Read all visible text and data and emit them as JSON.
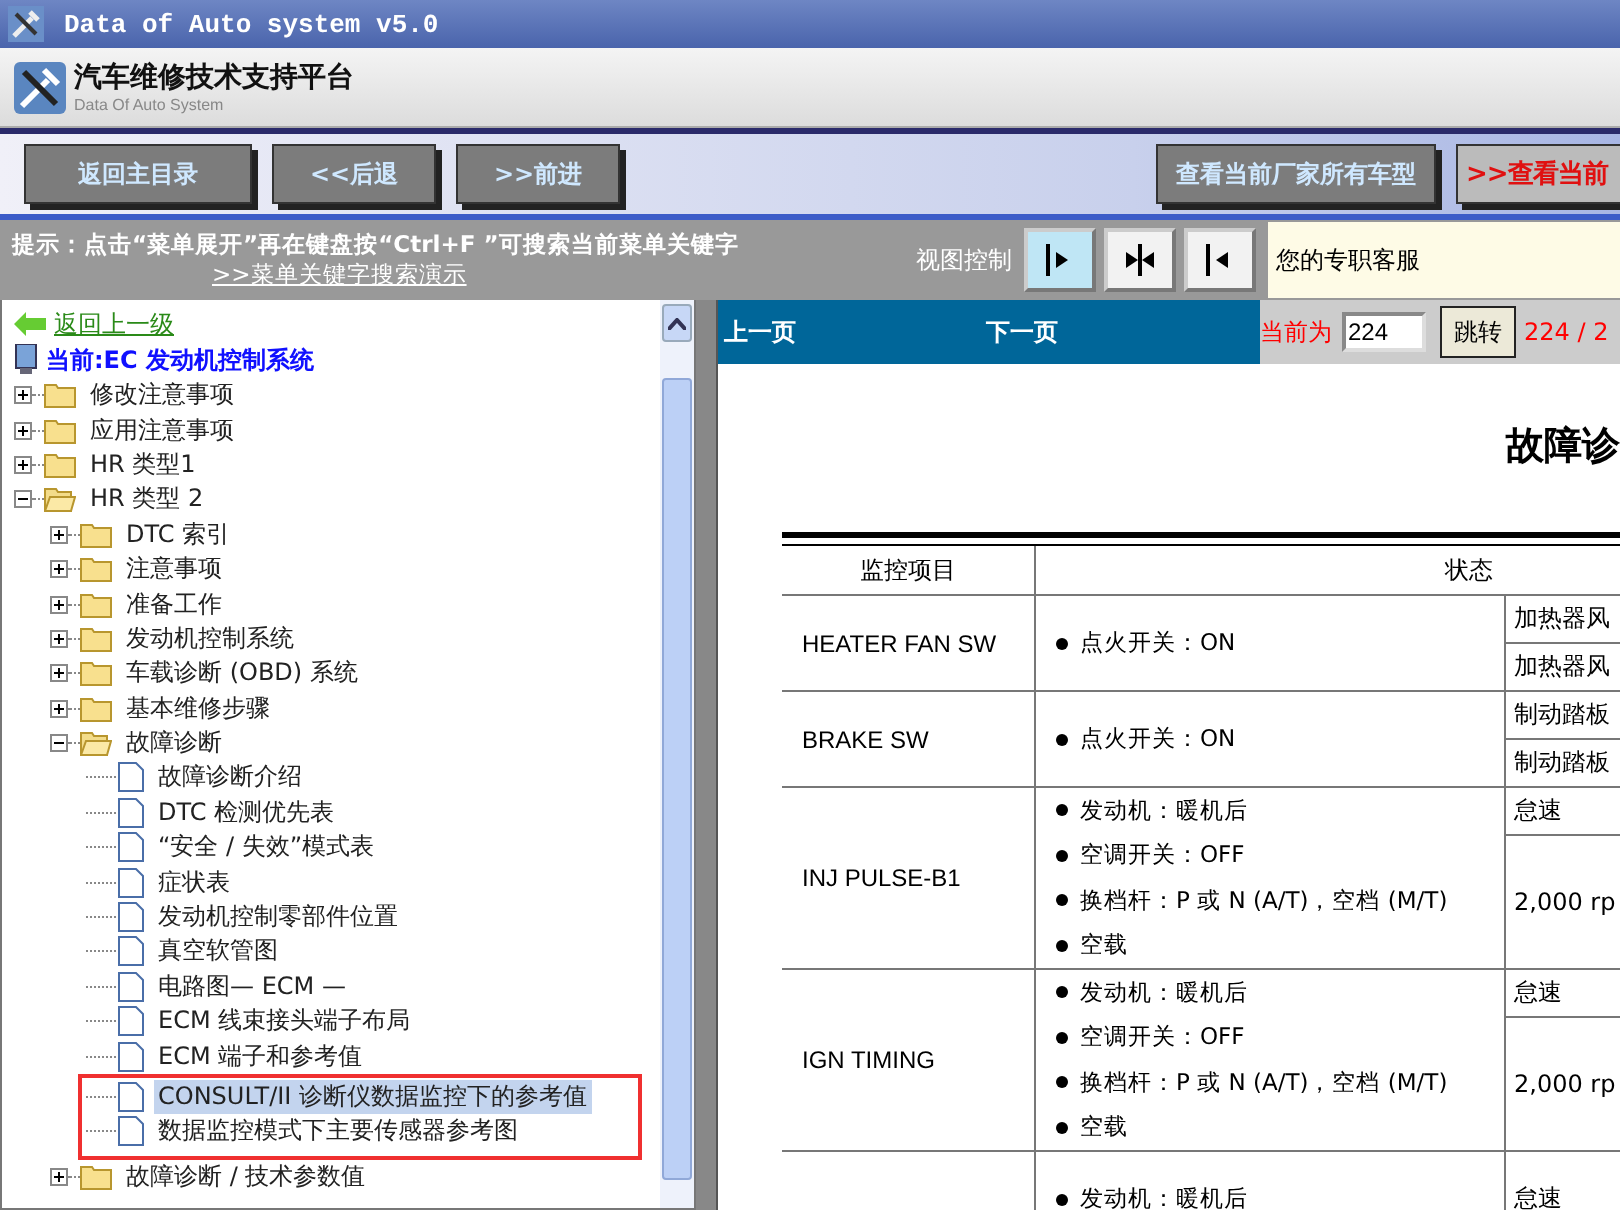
{
  "window": {
    "title": "Data of Auto system v5.0"
  },
  "header": {
    "title": "汽车维修技术支持平台",
    "subtitle": "Data Of Auto System"
  },
  "toolbar": {
    "buttons": [
      {
        "label": "返回主目录",
        "kind": "normal"
      },
      {
        "label": "<<后退",
        "kind": "normal"
      },
      {
        "label": ">>前进",
        "kind": "normal"
      },
      {
        "label": "查看当前厂家所有车型",
        "kind": "wide"
      },
      {
        "label": ">>查看当前",
        "kind": "alert"
      }
    ]
  },
  "hint": {
    "text": "提示：点击“菜单展开”再在键盘按“Ctrl+F ”可搜索当前菜单关键字",
    "link": ">>菜单关键字搜索演示"
  },
  "view_control": {
    "label": "视图控制",
    "buttons": [
      {
        "kind": "right"
      },
      {
        "kind": "collapse"
      },
      {
        "kind": "left"
      }
    ]
  },
  "service": {
    "text": "您的专职客服"
  },
  "tree": {
    "back": "返回上一级",
    "current": "当前:EC 发动机控制系统",
    "items": [
      {
        "label": "修改注意事项",
        "kind": "folder",
        "expanded": false,
        "selected": false,
        "annotated": false
      },
      {
        "label": "应用注意事项",
        "kind": "folder",
        "expanded": false,
        "selected": false,
        "annotated": false
      },
      {
        "label": "HR 类型1",
        "kind": "folder",
        "expanded": false,
        "selected": false,
        "annotated": false
      },
      {
        "label": "HR 类型  2",
        "kind": "folder",
        "expanded": true,
        "selected": false,
        "annotated": false,
        "children": [
          {
            "label": "DTC 索引",
            "kind": "folder",
            "expanded": false,
            "selected": false,
            "annotated": false
          },
          {
            "label": "注意事项",
            "kind": "folder",
            "expanded": false,
            "selected": false,
            "annotated": false
          },
          {
            "label": "准备工作",
            "kind": "folder",
            "expanded": false,
            "selected": false,
            "annotated": false
          },
          {
            "label": "发动机控制系统",
            "kind": "folder",
            "expanded": false,
            "selected": false,
            "annotated": false
          },
          {
            "label": "车载诊断 (OBD) 系统",
            "kind": "folder",
            "expanded": false,
            "selected": false,
            "annotated": false
          },
          {
            "label": "基本维修步骤",
            "kind": "folder",
            "expanded": false,
            "selected": false,
            "annotated": false
          },
          {
            "label": "故障诊断",
            "kind": "folder",
            "expanded": true,
            "selected": false,
            "annotated": false,
            "children": [
              {
                "label": "故障诊断介绍",
                "kind": "page",
                "selected": false,
                "annotated": false
              },
              {
                "label": "DTC 检测优先表",
                "kind": "page",
                "selected": false,
                "annotated": false
              },
              {
                "label": "“安全 / 失效”模式表",
                "kind": "page",
                "selected": false,
                "annotated": false
              },
              {
                "label": "症状表",
                "kind": "page",
                "selected": false,
                "annotated": false
              },
              {
                "label": "发动机控制零部件位置",
                "kind": "page",
                "selected": false,
                "annotated": false
              },
              {
                "label": "真空软管图",
                "kind": "page",
                "selected": false,
                "annotated": false
              },
              {
                "label": "电路图— ECM —",
                "kind": "page",
                "selected": false,
                "annotated": false
              },
              {
                "label": "ECM 线束接头端子布局",
                "kind": "page",
                "selected": false,
                "annotated": false
              },
              {
                "label": "ECM 端子和参考值",
                "kind": "page",
                "selected": false,
                "annotated": false
              },
              {
                "label": "CONSULT/II 诊断仪数据监控下的参考值",
                "kind": "page",
                "selected": true,
                "annotated": true
              },
              {
                "label": "数据监控模式下主要传感器参考图",
                "kind": "page",
                "selected": false,
                "annotated": true
              }
            ]
          },
          {
            "label": "故障诊断 / 技术参数值",
            "kind": "folder",
            "expanded": false,
            "selected": false,
            "annotated": false
          }
        ]
      }
    ]
  },
  "pager": {
    "prev": "上一页",
    "next": "下一页",
    "current_label": "当前为",
    "page_value": "224",
    "jump": "跳转",
    "total": "224 / 2"
  },
  "document": {
    "title": "故障诊",
    "table": {
      "columns": [
        "监控项目",
        "状态"
      ],
      "rows": [
        {
          "item": "HEATER FAN SW",
          "conditions": [
            "点火开关：ON"
          ],
          "states": [
            "加热器风",
            "加热器风"
          ]
        },
        {
          "item": "BRAKE SW",
          "conditions": [
            "点火开关：ON"
          ],
          "states": [
            "制动踏板",
            "制动踏板"
          ]
        },
        {
          "item": "INJ PULSE-B1",
          "conditions": [
            "发动机：暖机后",
            "空调开关：OFF",
            "换档杆：P 或 N (A/T)，空档 (M/T)",
            "空载"
          ],
          "states": [
            "怠速",
            "2,000 rp"
          ]
        },
        {
          "item": "IGN TIMING",
          "conditions": [
            "发动机：暖机后",
            "空调开关：OFF",
            "换档杆：P 或 N (A/T)，空档 (M/T)",
            "空载"
          ],
          "states": [
            "怠速",
            "2,000 rp"
          ]
        },
        {
          "conditions": [
            "发动机：暖机后"
          ],
          "states": [
            "怠速"
          ]
        }
      ]
    }
  }
}
